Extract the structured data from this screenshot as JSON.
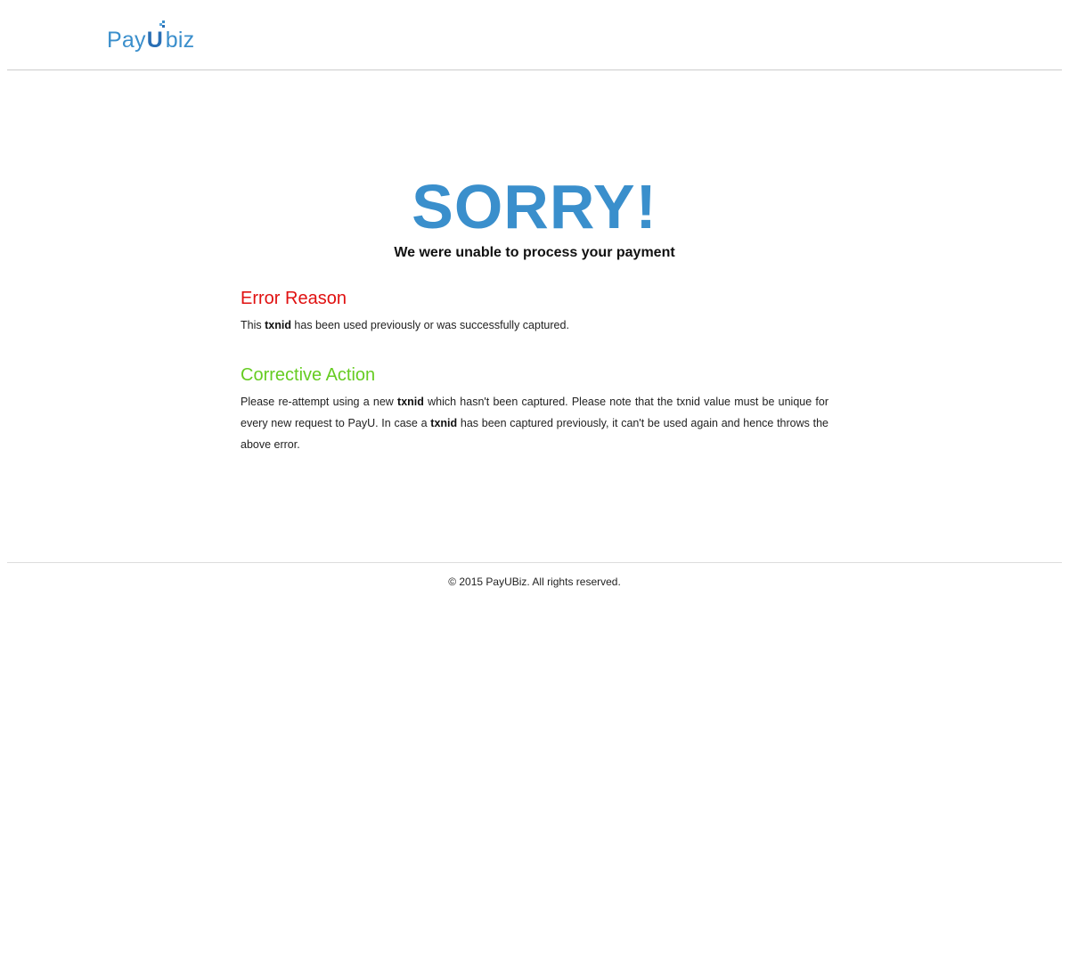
{
  "header": {
    "logo": {
      "part1": "Pay",
      "part2": "U",
      "part3": "biz",
      "brand_color": "#3b8fcc",
      "accent_color": "#2a6fb5"
    }
  },
  "main": {
    "title": "SORRY!",
    "subtitle": "We were unable to process your payment",
    "error_section": {
      "heading": "Error Reason",
      "heading_color": "#e01010",
      "text_before": "This ",
      "text_bold": "txnid",
      "text_after": " has been used previously or was successfully captured."
    },
    "action_section": {
      "heading": "Corrective Action",
      "heading_color": "#66cc22",
      "seg1": "Please re-attempt using a new ",
      "bold1": "txnid",
      "seg2": " which hasn't been captured. Please note that the txnid value must be unique for every new request to PayU. In case a ",
      "bold2": "txnid",
      "seg3": " has been captured previously, it can't be used again and hence throws the above error."
    }
  },
  "footer": {
    "copyright": "© 2015 PayUBiz. All rights reserved."
  }
}
